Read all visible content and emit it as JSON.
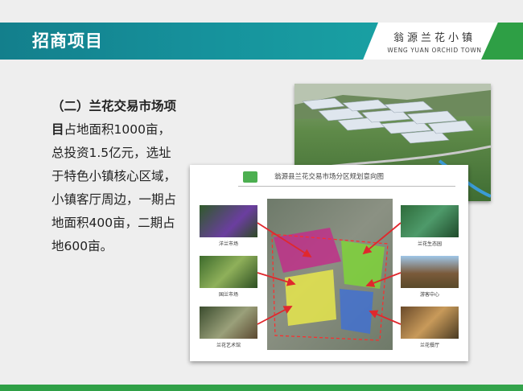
{
  "header": {
    "title": "招商项目",
    "brand_cn": "翁源兰花小镇",
    "brand_en": "WENG YUAN ORCHID TOWN"
  },
  "content": {
    "heading": "（二）兰花交易市场项目",
    "body": "占地面积1000亩，总投资1.5亿元，选址于特色小镇核心区域，小镇客厅周边，一期占地面积400亩，二期占地600亩。"
  },
  "plan": {
    "title": "翁源县兰花交易市场分区规划意向图",
    "thumbnails": [
      {
        "label": "洋兰市场"
      },
      {
        "label": "国兰市场"
      },
      {
        "label": "兰花艺术馆"
      },
      {
        "label": "兰花生态园"
      },
      {
        "label": "游客中心"
      },
      {
        "label": "兰花餐厅"
      }
    ]
  },
  "colors": {
    "header_teal": "#137f8c",
    "accent_green": "#2e9f45",
    "zone_magenta": "#c0308a",
    "zone_green": "#7fd33a",
    "zone_yellow": "#e6e64c",
    "zone_blue": "#3e6fd6",
    "arrow_red": "#e0282d"
  }
}
